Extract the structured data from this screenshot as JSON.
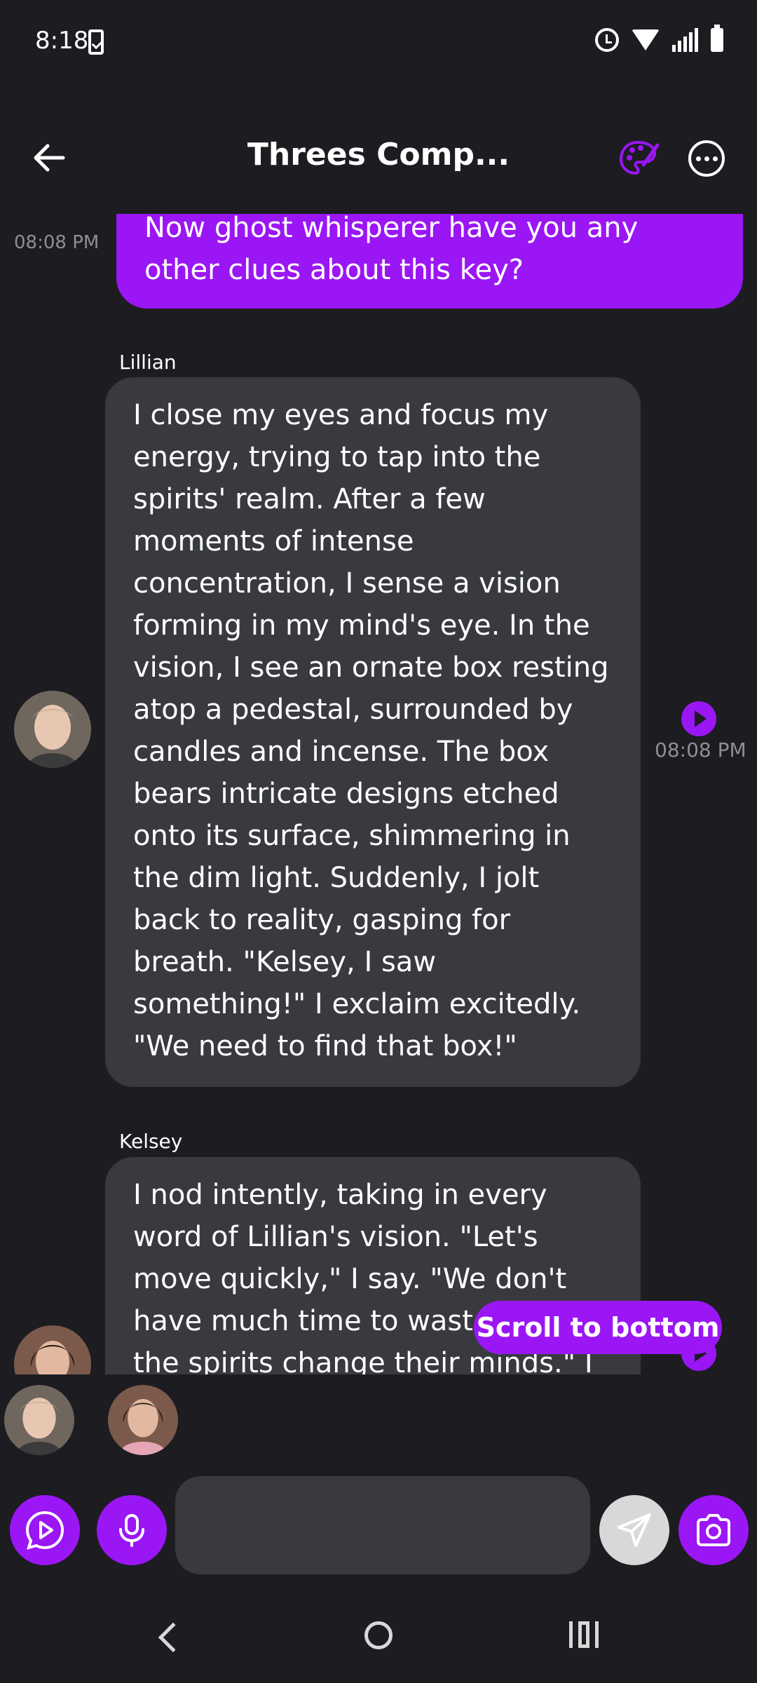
{
  "status_bar": {
    "time": "8:18"
  },
  "header": {
    "title": "Threes Comp..."
  },
  "chat": {
    "user_message": {
      "text": "Now ghost whisperer have you any other clues about this key?",
      "time": "08:08 PM"
    },
    "messages": [
      {
        "sender": "Lillian",
        "text": "I close my eyes and focus my energy, trying to tap into the spirits' realm. After a few moments of intense concentration, I sense a vision forming in my mind's eye. In the vision, I see an ornate box resting atop a pedestal, surrounded by candles and incense. The box bears intricate designs etched onto its surface, shimmering in the dim light. Suddenly, I jolt back to reality, gasping for breath. \"Kelsey, I saw something!\" I exclaim excitedly. \"We need to find that box!\"",
        "time": "08:08 PM"
      },
      {
        "sender": "Kelsey",
        "text": "I nod intently, taking in every word of Lillian's vision. \"Let's move quickly,\" I say. \"We don't have much time to waste before the spirits change their minds.\" I take"
      }
    ],
    "scroll_to_bottom_label": "Scroll to bottom"
  },
  "input": {
    "placeholder": ""
  },
  "colors": {
    "accent": "#9b16f5",
    "background": "#1c1c21",
    "bubble": "#383a40"
  }
}
